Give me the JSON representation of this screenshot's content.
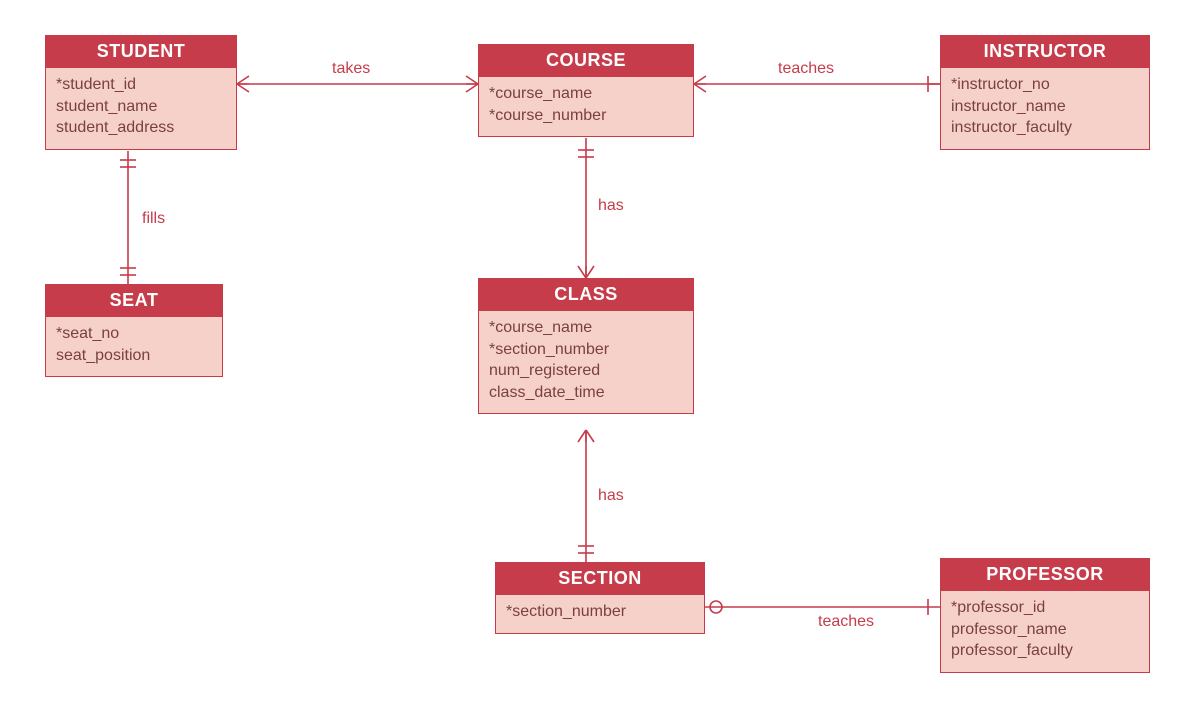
{
  "colors": {
    "accent": "#c63c4a",
    "fill": "#f6d1ca",
    "attrText": "#7a4040"
  },
  "entities": {
    "student": {
      "title": "STUDENT",
      "attrs": [
        "*student_id",
        "student_name",
        "student_address"
      ]
    },
    "course": {
      "title": "COURSE",
      "attrs": [
        "*course_name",
        "*course_number"
      ]
    },
    "instructor": {
      "title": "INSTRUCTOR",
      "attrs": [
        "*instructor_no",
        "instructor_name",
        "instructor_faculty"
      ]
    },
    "seat": {
      "title": "SEAT",
      "attrs": [
        "*seat_no",
        "seat_position"
      ]
    },
    "class": {
      "title": "CLASS",
      "attrs": [
        "*course_name",
        "*section_number",
        "num_registered",
        "class_date_time"
      ]
    },
    "section": {
      "title": "SECTION",
      "attrs": [
        "*section_number"
      ]
    },
    "professor": {
      "title": "PROFESSOR",
      "attrs": [
        "*professor_id",
        "professor_name",
        "professor_faculty"
      ]
    }
  },
  "relationships": {
    "takes": {
      "label": "takes"
    },
    "teaches1": {
      "label": "teaches"
    },
    "fills": {
      "label": "fills"
    },
    "has1": {
      "label": "has"
    },
    "has2": {
      "label": "has"
    },
    "teaches2": {
      "label": "teaches"
    }
  }
}
